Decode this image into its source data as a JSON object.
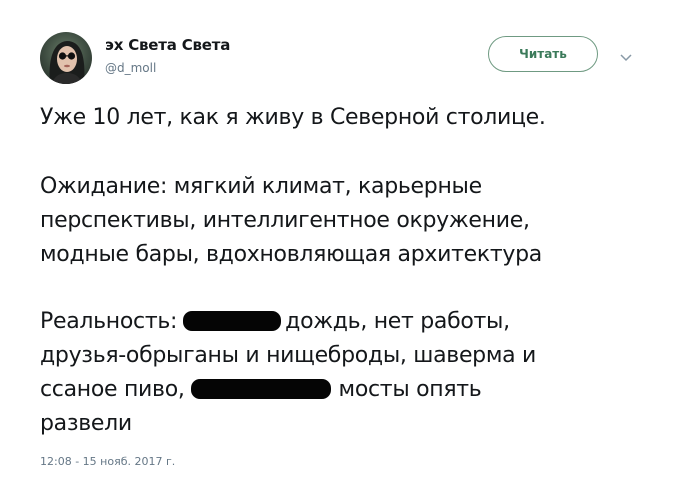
{
  "user": {
    "display_name": "эх Света Света",
    "handle": "@d_moll"
  },
  "follow_button_label": "Читать",
  "tweet": {
    "line1": "Уже 10 лет, как я живу в Северной столице.",
    "expectation_line1": "Ожидание: мягкий климат, карьерные",
    "expectation_line2": "перспективы, интеллигентное окружение,",
    "expectation_line3": "модные бары, вдохновляющая архитектура",
    "reality_prefix": "Реальность:",
    "reality_after_redaction": "дождь, нет работы,",
    "reality_line2": "друзья-обрыганы и нищеброды, шаверма и",
    "reality_line3_start": "ссаное пиво,",
    "reality_line3_end": "мосты опять",
    "reality_line4": "развели"
  },
  "timestamp": "12:08 - 15 нояб. 2017 г.",
  "colors": {
    "text": "#14171a",
    "muted": "#657786",
    "follow_border": "#6f9a82"
  },
  "icons": [
    "avatar-photo",
    "chevron-down-icon"
  ]
}
